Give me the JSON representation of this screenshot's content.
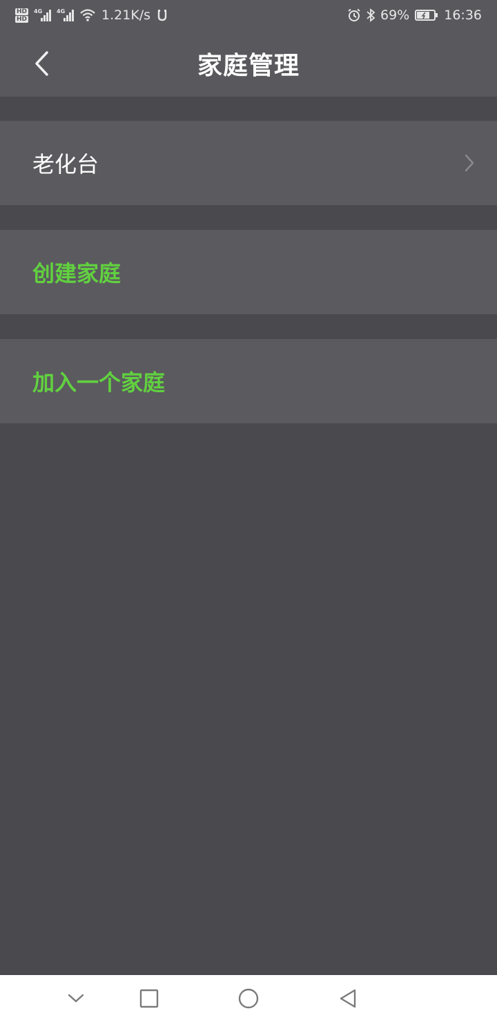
{
  "status_bar": {
    "hd_labels": [
      "HD",
      "HD"
    ],
    "network_tags": [
      "4G",
      "4G"
    ],
    "speed": "1.21K/s",
    "battery_percent": "69%",
    "time": "16:36"
  },
  "header": {
    "title": "家庭管理"
  },
  "list": {
    "items": [
      {
        "label": "老化台",
        "color": "#ffffff"
      },
      {
        "label": "创建家庭",
        "color": "#61d13f"
      },
      {
        "label": "加入一个家庭",
        "color": "#61d13f"
      }
    ]
  },
  "nav_bar": {
    "icons": [
      "chevron-down-icon",
      "square-icon",
      "circle-icon",
      "triangle-back-icon"
    ]
  },
  "colors": {
    "accent_green": "#61d13f",
    "background": "#4a494e",
    "row_background": "#5b5a5f",
    "header_background": "#59585d"
  }
}
